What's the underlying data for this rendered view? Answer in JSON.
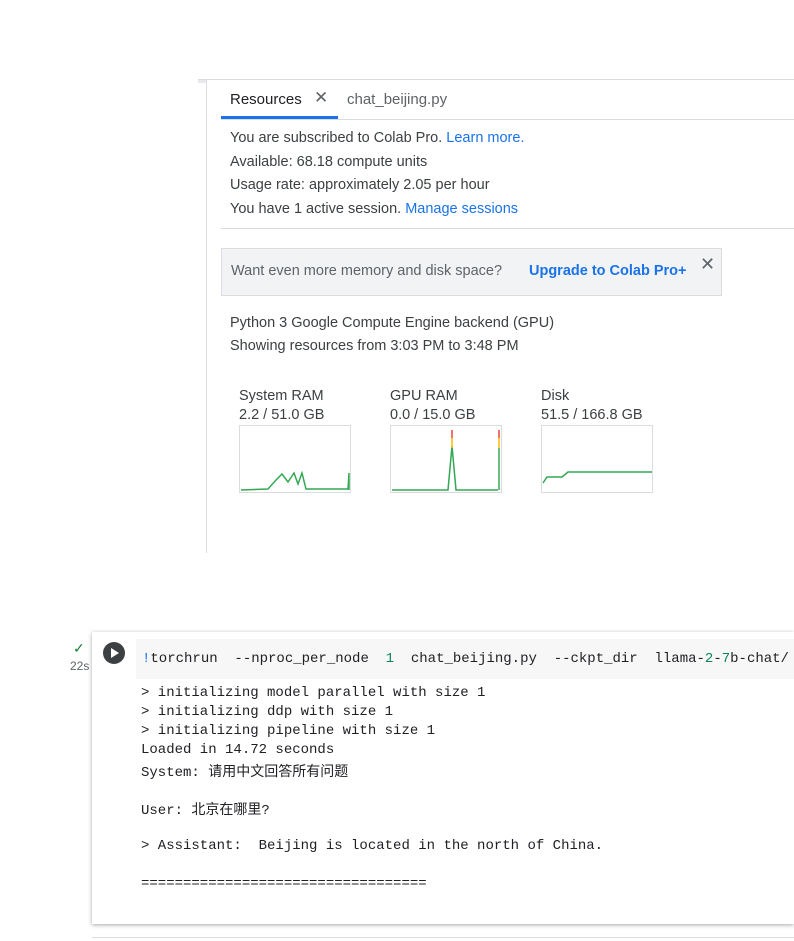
{
  "tabs": {
    "resources_label": "Resources",
    "close_glyph": "✕",
    "file_label": "chat_beijing.py"
  },
  "subscription": {
    "text": "You are subscribed to Colab Pro.",
    "link": "Learn more."
  },
  "available": "Available: 68.18 compute units",
  "usage_rate": "Usage rate: approximately 2.05 per hour",
  "session": {
    "text": "You have 1 active session.",
    "link": "Manage sessions"
  },
  "promo": {
    "text": "Want even more memory and disk space?",
    "link": "Upgrade to Colab Pro+",
    "close_glyph": "✕"
  },
  "backend": {
    "line1": "Python 3 Google Compute Engine backend (GPU)",
    "line2": "Showing resources from 3:03 PM to 3:48 PM"
  },
  "gauges": [
    {
      "label": "System RAM",
      "value": "2.2 / 51.0 GB"
    },
    {
      "label": "GPU RAM",
      "value": "0.0 / 15.0 GB"
    },
    {
      "label": "Disk",
      "value": "51.5 / 166.8 GB"
    }
  ],
  "colors": {
    "accent": "#1a73e8",
    "graph_line": "#34a853",
    "graph_spike_warn": "#fbbc04",
    "graph_spike_alert": "#ea4335"
  },
  "cell": {
    "status_glyph": "✓",
    "exec_time": "22s",
    "code_bang": "!",
    "code_part1": "torchrun  --nproc_per_node  ",
    "code_num1": "1",
    "code_part2": "  chat_beijing.py  --ckpt_dir  llama-",
    "code_num2": "2",
    "code_dash": "-",
    "code_num3": "7",
    "code_part3": "b-chat/  --t",
    "output": [
      "> initializing model parallel with size 1",
      "> initializing ddp with size 1",
      "> initializing pipeline with size 1",
      "Loaded in 14.72 seconds",
      "System: 请用中文回答所有问题",
      "",
      "User: 北京在哪里?",
      "",
      "> Assistant:  Beijing is located in the north of China.",
      "",
      "=================================="
    ]
  }
}
